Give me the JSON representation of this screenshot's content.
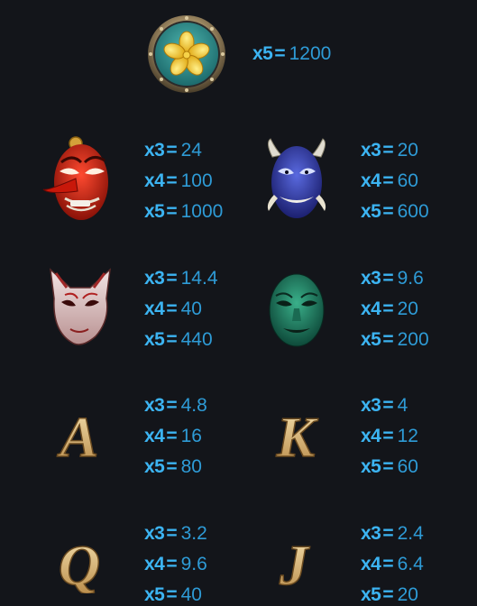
{
  "top": {
    "symbol": "flower-coin-icon",
    "pays": [
      {
        "mult": "x5",
        "value": "1200"
      }
    ]
  },
  "rows": [
    {
      "left": {
        "symbol": "red-tengu-mask-icon",
        "pays": [
          {
            "mult": "x3",
            "value": "24"
          },
          {
            "mult": "x4",
            "value": "100"
          },
          {
            "mult": "x5",
            "value": "1000"
          }
        ]
      },
      "right": {
        "symbol": "blue-oni-mask-icon",
        "pays": [
          {
            "mult": "x3",
            "value": "20"
          },
          {
            "mult": "x4",
            "value": "60"
          },
          {
            "mult": "x5",
            "value": "600"
          }
        ]
      }
    },
    {
      "left": {
        "symbol": "fox-mask-icon",
        "pays": [
          {
            "mult": "x3",
            "value": "14.4"
          },
          {
            "mult": "x4",
            "value": "40"
          },
          {
            "mult": "x5",
            "value": "440"
          }
        ]
      },
      "right": {
        "symbol": "green-mask-icon",
        "pays": [
          {
            "mult": "x3",
            "value": "9.6"
          },
          {
            "mult": "x4",
            "value": "20"
          },
          {
            "mult": "x5",
            "value": "200"
          }
        ]
      }
    },
    {
      "left": {
        "symbol": "letter-a-icon",
        "letter": "A",
        "pays": [
          {
            "mult": "x3",
            "value": "4.8"
          },
          {
            "mult": "x4",
            "value": "16"
          },
          {
            "mult": "x5",
            "value": "80"
          }
        ]
      },
      "right": {
        "symbol": "letter-k-icon",
        "letter": "K",
        "pays": [
          {
            "mult": "x3",
            "value": "4"
          },
          {
            "mult": "x4",
            "value": "12"
          },
          {
            "mult": "x5",
            "value": "60"
          }
        ]
      }
    },
    {
      "left": {
        "symbol": "letter-q-icon",
        "letter": "Q",
        "pays": [
          {
            "mult": "x3",
            "value": "3.2"
          },
          {
            "mult": "x4",
            "value": "9.6"
          },
          {
            "mult": "x5",
            "value": "40"
          }
        ]
      },
      "right": {
        "symbol": "letter-j-icon",
        "letter": "J",
        "pays": [
          {
            "mult": "x3",
            "value": "2.4"
          },
          {
            "mult": "x4",
            "value": "6.4"
          },
          {
            "mult": "x5",
            "value": "20"
          }
        ]
      }
    }
  ],
  "colors": {
    "background": "#13151a",
    "pay_text": "#2aa3e6",
    "letter_gold": "#e8c98f"
  }
}
